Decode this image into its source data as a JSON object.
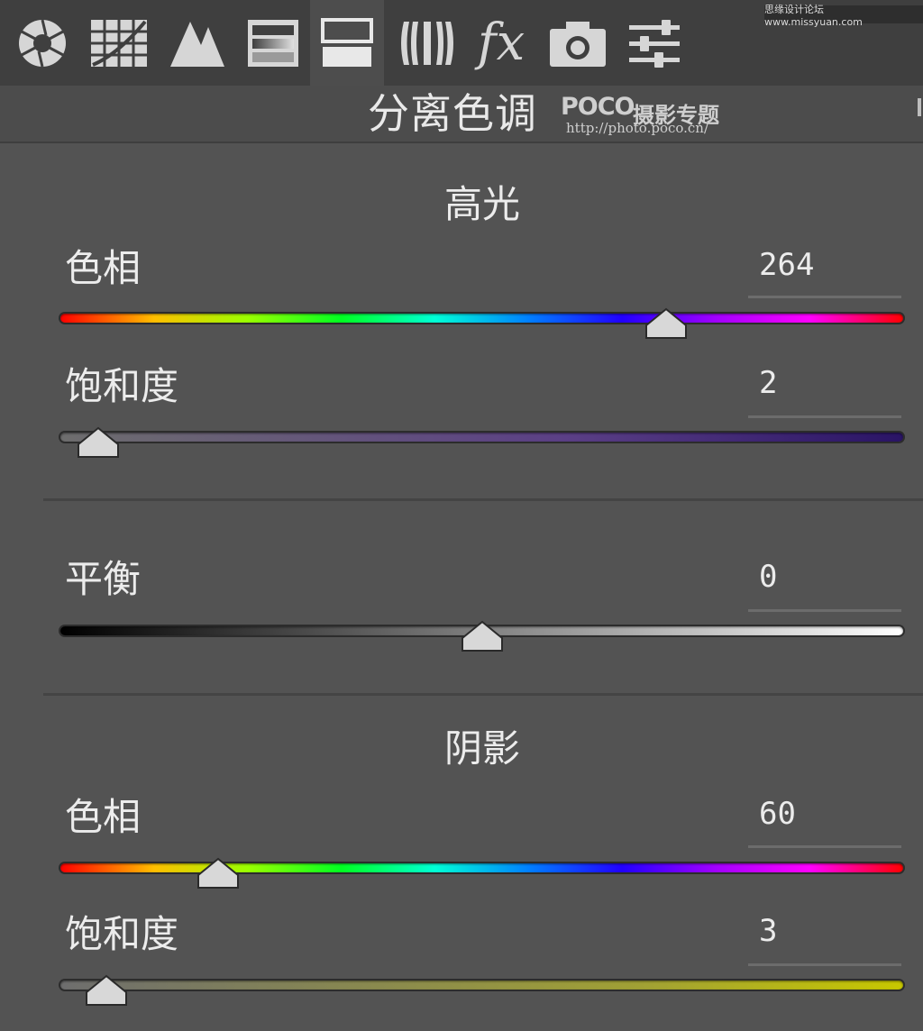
{
  "credit": "思缘设计论坛 www.missyuan.com",
  "toolbar": {
    "tools": [
      {
        "icon": "aperture-icon"
      },
      {
        "icon": "tone-curve-icon"
      },
      {
        "icon": "detail-icon"
      },
      {
        "icon": "hsl-icon"
      },
      {
        "icon": "split-toning-icon"
      },
      {
        "icon": "lens-corrections-icon"
      },
      {
        "icon": "fx-icon",
        "text": "fx"
      },
      {
        "icon": "camera-calibration-icon"
      },
      {
        "icon": "presets-sliders-icon"
      }
    ],
    "active_index": 4
  },
  "panel": {
    "title": "分离色调",
    "watermark_logo": "POCO",
    "watermark_subtitle": "摄影专题",
    "watermark_url": "http://photo.poco.cn/"
  },
  "highlights": {
    "title": "高光",
    "hue": {
      "label": "色相",
      "value": "264",
      "position": 0.73
    },
    "saturation": {
      "label": "饱和度",
      "value": "2",
      "position": 0.02
    }
  },
  "balance": {
    "label": "平衡",
    "value": "0",
    "position": 0.5
  },
  "shadows": {
    "title": "阴影",
    "hue": {
      "label": "色相",
      "value": "60",
      "position": 0.17
    },
    "saturation": {
      "label": "饱和度",
      "value": "3",
      "position": 0.03
    }
  },
  "colors": {
    "highlight_sat_track": "#5b3f86",
    "shadow_sat_track": "#a2a233"
  }
}
